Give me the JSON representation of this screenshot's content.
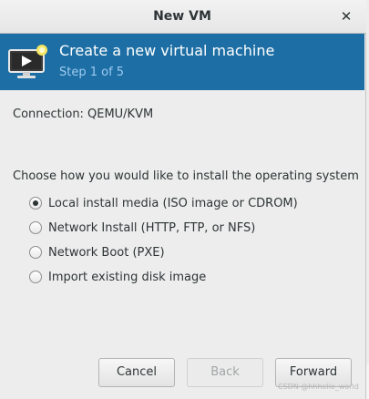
{
  "window": {
    "title": "New VM",
    "close_glyph": "✕"
  },
  "banner": {
    "title": "Create a new virtual machine",
    "step": "Step 1 of 5",
    "icon": "monitor-play-icon"
  },
  "connection": {
    "label": "Connection:",
    "value": "QEMU/KVM"
  },
  "install": {
    "prompt": "Choose how you would like to install the operating system",
    "options": [
      {
        "label": "Local install media (ISO image or CDROM)",
        "checked": true
      },
      {
        "label": "Network Install (HTTP, FTP, or NFS)",
        "checked": false
      },
      {
        "label": "Network Boot (PXE)",
        "checked": false
      },
      {
        "label": "Import existing disk image",
        "checked": false
      }
    ]
  },
  "buttons": {
    "cancel": "Cancel",
    "back": "Back",
    "forward": "Forward"
  },
  "watermark": "CSDN @hhhello_world"
}
